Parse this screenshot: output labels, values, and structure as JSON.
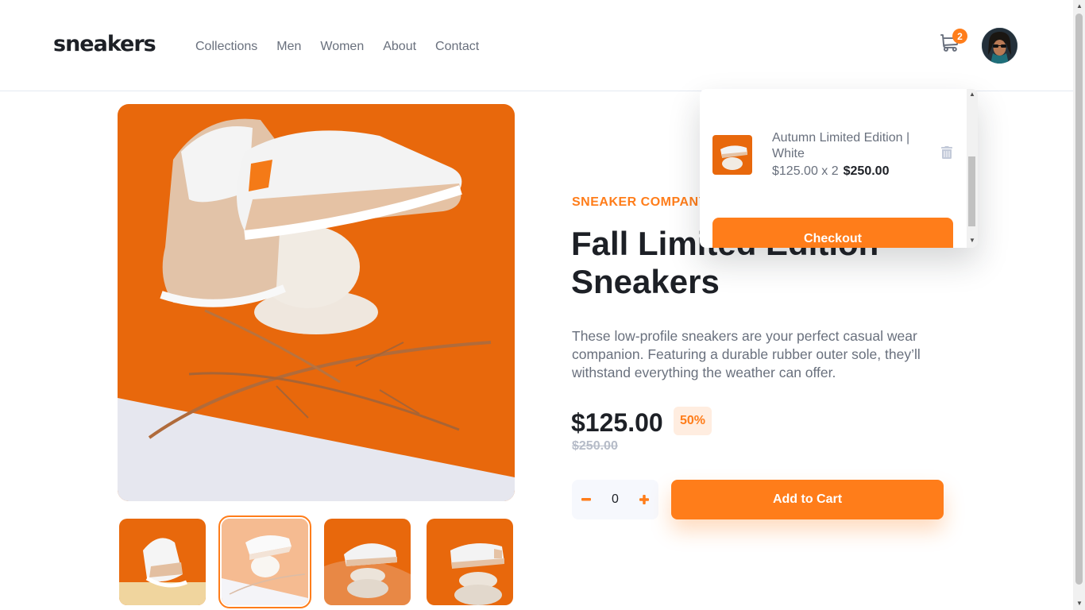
{
  "header": {
    "logo": "sneakers",
    "nav": [
      "Collections",
      "Men",
      "Women",
      "About",
      "Contact"
    ],
    "cart_count": "2"
  },
  "product": {
    "company": "SNEAKER COMPANY",
    "title": "Fall Limited Edition Sneakers",
    "description": "These low-profile sneakers are your perfect casual wear companion. Featuring a durable rubber outer sole, they’ll withstand everything the weather can offer.",
    "price": "$125.00",
    "discount": "50%",
    "old_price": "$250.00",
    "quantity": "0",
    "add_to_cart_label": "Add to Cart",
    "selected_thumbnail": 2
  },
  "cart": {
    "item_name": "Autumn Limited Edition | White",
    "item_price_line": "$125.00 x 2",
    "item_total": "$250.00",
    "checkout_label": "Checkout"
  },
  "colors": {
    "accent": "#ff7d1a",
    "accent_light": "#ffede0",
    "text_dark": "#1d2026",
    "text_muted": "#69707d"
  },
  "icons": [
    "cart-icon",
    "avatar",
    "minus-icon",
    "plus-icon",
    "trash-icon"
  ]
}
